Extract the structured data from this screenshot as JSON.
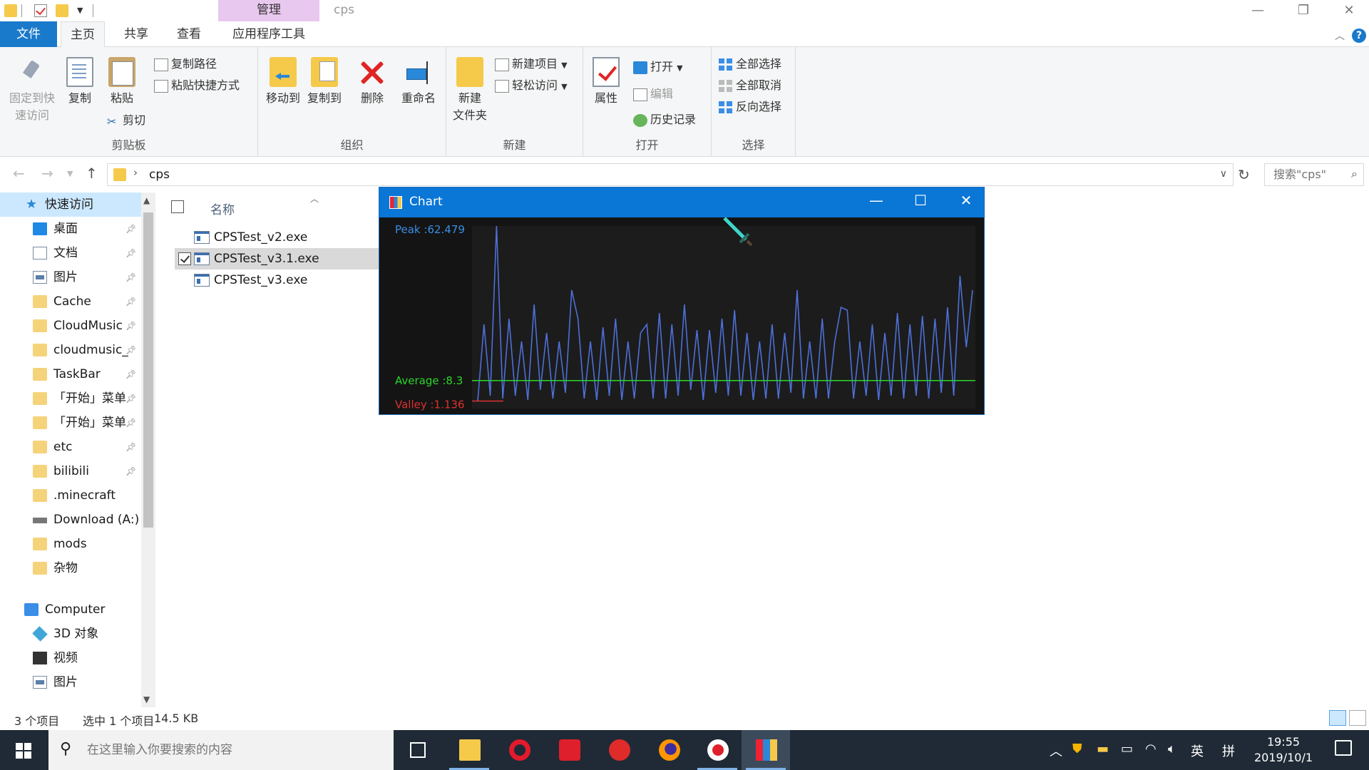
{
  "window": {
    "title": "cps",
    "context_tab": "管理",
    "controls": {
      "minimize": "—",
      "restore": "❐",
      "close": "✕"
    }
  },
  "ribbon_tabs": [
    {
      "label": "文件"
    },
    {
      "label": "主页"
    },
    {
      "label": "共享"
    },
    {
      "label": "查看"
    },
    {
      "label": "应用程序工具"
    }
  ],
  "ribbon": {
    "clipboard": {
      "label": "剪贴板",
      "pin": "固定到快\n速访问",
      "copy": "复制",
      "paste": "粘贴",
      "copy_path": "复制路径",
      "paste_shortcut": "粘贴快捷方式",
      "cut": "剪切"
    },
    "organize": {
      "label": "组织",
      "move_to": "移动到",
      "copy_to": "复制到",
      "delete": "删除",
      "rename": "重命名"
    },
    "new": {
      "label": "新建",
      "new_folder": "新建\n文件夹",
      "new_item": "新建项目",
      "easy_access": "轻松访问"
    },
    "open": {
      "label": "打开",
      "properties": "属性",
      "open": "打开",
      "edit": "编辑",
      "history": "历史记录"
    },
    "select": {
      "label": "选择",
      "select_all": "全部选择",
      "select_none": "全部取消",
      "invert": "反向选择"
    }
  },
  "address": {
    "path": "cps",
    "search_placeholder": "搜索\"cps\""
  },
  "nav": {
    "quick_access": "快速访问",
    "items": [
      {
        "label": "桌面",
        "icon": "desktop-icon",
        "pinned": true
      },
      {
        "label": "文档",
        "icon": "documents-icon",
        "pinned": true
      },
      {
        "label": "图片",
        "icon": "pictures-icon",
        "pinned": true
      },
      {
        "label": "Cache",
        "icon": "folder-icon",
        "pinned": true
      },
      {
        "label": "CloudMusic",
        "icon": "folder-icon",
        "pinned": true
      },
      {
        "label": "cloudmusic_",
        "icon": "folder-icon",
        "pinned": true
      },
      {
        "label": "TaskBar",
        "icon": "folder-icon",
        "pinned": true
      },
      {
        "label": "「开始」菜单",
        "icon": "folder-icon",
        "pinned": true
      },
      {
        "label": "「开始」菜单",
        "icon": "folder-icon",
        "pinned": true
      },
      {
        "label": "etc",
        "icon": "folder-icon",
        "pinned": true
      },
      {
        "label": "bilibili",
        "icon": "folder-icon",
        "pinned": true
      },
      {
        "label": ".minecraft",
        "icon": "folder-icon",
        "pinned": false
      },
      {
        "label": "Download (A:)",
        "icon": "drive-icon",
        "pinned": false
      },
      {
        "label": "mods",
        "icon": "folder-icon",
        "pinned": false
      },
      {
        "label": "杂物",
        "icon": "folder-icon",
        "pinned": false
      }
    ],
    "computer": "Computer",
    "computer_items": [
      {
        "label": "3D 对象",
        "icon": "3d-objects-icon"
      },
      {
        "label": "视频",
        "icon": "videos-icon"
      },
      {
        "label": "图片",
        "icon": "pictures-icon"
      }
    ]
  },
  "file_list": {
    "column_name": "名称",
    "files": [
      {
        "name": "CPSTest_v2.exe",
        "selected": false
      },
      {
        "name": "CPSTest_v3.1.exe",
        "selected": true
      },
      {
        "name": "CPSTest_v3.exe",
        "selected": false
      }
    ]
  },
  "chart_window": {
    "title": "Chart",
    "controls": {
      "minimize": "—",
      "maximize": "☐",
      "close": "✕"
    }
  },
  "chart_data": {
    "type": "line",
    "labels": {
      "peak": "Peak :62.479",
      "average": "Average :8.3",
      "valley": "Valley :1.136"
    },
    "peak": 62.479,
    "average": 8.3,
    "valley": 1.136,
    "ylim": [
      0,
      62.479
    ],
    "series": [
      {
        "name": "",
        "color": "#4d6fd9",
        "values": [
          1.1,
          28,
          3,
          62.5,
          2,
          30,
          3,
          22,
          1.5,
          35,
          5,
          25,
          2,
          22,
          4,
          40,
          30,
          2,
          22,
          1.5,
          27,
          3,
          30,
          1.5,
          22,
          2,
          25,
          28,
          2,
          32,
          2,
          28,
          3,
          35,
          5,
          26,
          1.5,
          26,
          4,
          30,
          3,
          33,
          3,
          25,
          1.5,
          22,
          2,
          28,
          2,
          25,
          4,
          40,
          2,
          22,
          2,
          30,
          2,
          22,
          34,
          33,
          2,
          22,
          3,
          28,
          1.5,
          25,
          3,
          32,
          2,
          28,
          3,
          31,
          2,
          30,
          4,
          34,
          3,
          45,
          20,
          40
        ]
      },
      {
        "name": "",
        "color": "#2bd62b",
        "values": "constant average"
      },
      {
        "name": "",
        "color": "#e03030",
        "values": "constant valley"
      }
    ],
    "grid": false,
    "legend": "left"
  },
  "status": {
    "count": "3 个项目",
    "selected": "选中 1 个项目",
    "size": "14.5 KB"
  },
  "taskbar": {
    "search_placeholder": "在这里输入你要搜索的内容",
    "apps": [
      "task-view-icon",
      "file-explorer-icon",
      "opera-icon",
      "youdao-icon",
      "netease-music-icon",
      "firefox-icon",
      "obs-record-icon",
      "chart-app-icon"
    ],
    "ime_lang": "英",
    "ime_mode": "拼",
    "time": "19:55",
    "date": "2019/10/1"
  },
  "colors": {
    "accent": "#1979ca",
    "chart_line": "#4d6fd9",
    "average": "#2bd62b",
    "valley": "#e03030",
    "peak_label": "#3a8ee6"
  }
}
